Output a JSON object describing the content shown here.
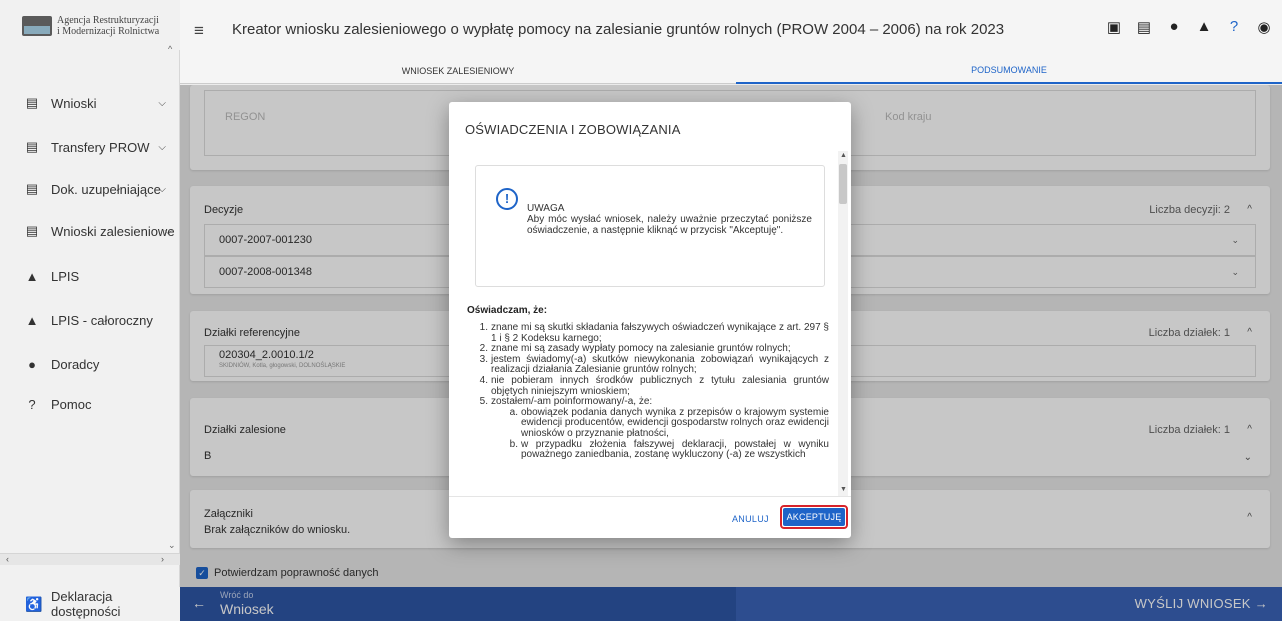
{
  "logo": {
    "line1": "Agencja Restrukturyzacji",
    "line2": "i Modernizacji Rolnictwa"
  },
  "sidebar": {
    "items": [
      {
        "label": "Wnioski",
        "icon": "document-icon",
        "chevron": "⌄"
      },
      {
        "label": "Transfery PROW",
        "icon": "document-icon",
        "chevron": "⌄"
      },
      {
        "label": "Dok. uzupełniające",
        "icon": "document-icon",
        "chevron": "⌄"
      },
      {
        "label": "Wnioski zalesieniowe",
        "icon": "document-icon",
        "chevron": "⌄"
      },
      {
        "label": "LPIS",
        "icon": "terrain-icon"
      },
      {
        "label": "LPIS - całoroczny",
        "icon": "terrain-icon"
      },
      {
        "label": "Doradcy",
        "icon": "person-icon"
      },
      {
        "label": "Pomoc",
        "icon": "help-icon"
      }
    ],
    "accessibility": "Deklaracja dostępności"
  },
  "header": {
    "title": "Kreator wniosku zalesieniowego o wypłatę pomocy na zalesianie gruntów rolnych (PROW 2004 – 2006) na rok 2023",
    "icons": [
      "save-icon",
      "print-icon",
      "info-icon",
      "notifications-icon",
      "help-icon",
      "account-icon"
    ]
  },
  "tabs": [
    {
      "label": "WNIOSEK ZALESIENIOWY",
      "active": false
    },
    {
      "label": "PODSUMOWANIE",
      "active": true
    }
  ],
  "main": {
    "regon_label": "REGON",
    "kod_kraju_label": "Kod kraju",
    "decyzje": {
      "header": "Decyzje",
      "count": "Liczba decyzji: 2",
      "rows": [
        "0007-2007-001230",
        "0007-2008-001348"
      ]
    },
    "dzialki_ref": {
      "header": "Działki referencyjne",
      "count": "Liczba działek: 1",
      "row_id": "020304_2.0010.1/2",
      "row_sub": "SKIDNIÓW, Kotla, głogowski, DOLNOŚLĄSKIE"
    },
    "dzialki_zal": {
      "header": "Działki zalesione",
      "count": "Liczba działek: 1",
      "row": "B"
    },
    "zalaczniki": {
      "header": "Załączniki",
      "text": "Brak załączników do wniosku."
    },
    "confirm": "Potwierdzam poprawność danych"
  },
  "bottom": {
    "back_small": "Wróć do",
    "back_big": "Wniosek",
    "send": "WYŚLIJ WNIOSEK"
  },
  "modal": {
    "title": "OŚWIADCZENIA I ZOBOWIĄZANIA",
    "uwaga_title": "UWAGA",
    "uwaga_text": "Aby móc wysłać wniosek, należy uważnie przeczytać poniższe oświadczenie, a następnie kliknąć w przycisk \"Akceptuję\".",
    "decl_heading": "Oświadczam, że:",
    "items": [
      "znane mi są skutki składania fałszywych oświadczeń wynikające z art. 297 § 1 i § 2 Kodeksu karnego;",
      "znane mi są zasady wypłaty pomocy na zalesianie gruntów rolnych;",
      "jestem świadomy(-a) skutków niewykonania zobowiązań wynikających z realizacji działania Zalesianie gruntów rolnych;",
      "nie pobieram innych środków publicznych z tytułu zalesiania gruntów objętych niniejszym wnioskiem;",
      "zostałem/-am poinformowany/-a, że:"
    ],
    "subitems": [
      "obowiązek podania danych wynika z przepisów o krajowym systemie ewidencji producentów, ewidencji gospodarstw rolnych oraz ewidencji wniosków o przyznanie płatności,",
      "w przypadku złożenia fałszywej deklaracji, powstałej w wyniku poważnego zaniedbania, zostanę wykluczony (-a) ze wszystkich"
    ],
    "cancel": "ANULUJ",
    "accept": "AKCEPTUJĘ"
  }
}
